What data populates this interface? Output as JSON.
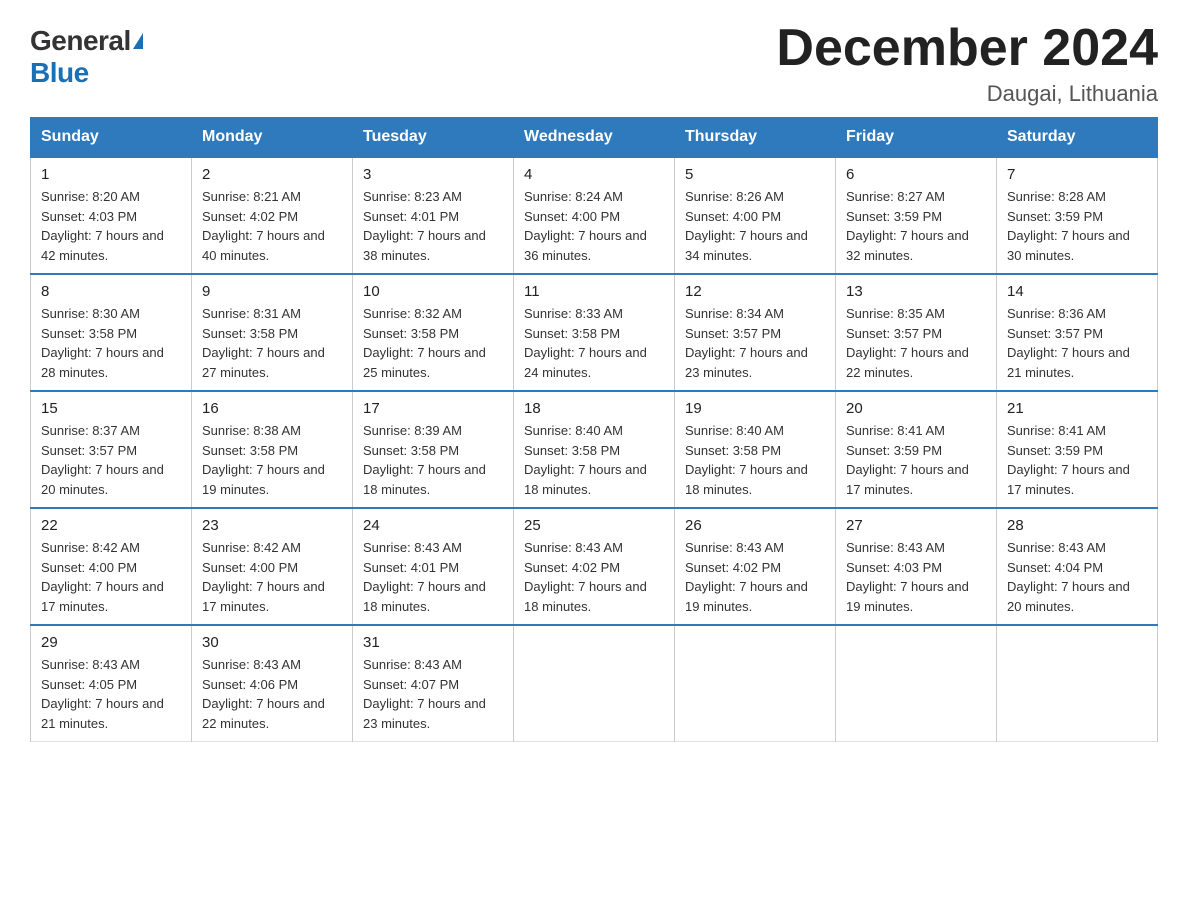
{
  "header": {
    "logo_general": "General",
    "logo_blue": "Blue",
    "month_title": "December 2024",
    "location": "Daugai, Lithuania"
  },
  "days_of_week": [
    "Sunday",
    "Monday",
    "Tuesday",
    "Wednesday",
    "Thursday",
    "Friday",
    "Saturday"
  ],
  "weeks": [
    [
      {
        "day": "1",
        "sunrise": "8:20 AM",
        "sunset": "4:03 PM",
        "daylight": "7 hours and 42 minutes."
      },
      {
        "day": "2",
        "sunrise": "8:21 AM",
        "sunset": "4:02 PM",
        "daylight": "7 hours and 40 minutes."
      },
      {
        "day": "3",
        "sunrise": "8:23 AM",
        "sunset": "4:01 PM",
        "daylight": "7 hours and 38 minutes."
      },
      {
        "day": "4",
        "sunrise": "8:24 AM",
        "sunset": "4:00 PM",
        "daylight": "7 hours and 36 minutes."
      },
      {
        "day": "5",
        "sunrise": "8:26 AM",
        "sunset": "4:00 PM",
        "daylight": "7 hours and 34 minutes."
      },
      {
        "day": "6",
        "sunrise": "8:27 AM",
        "sunset": "3:59 PM",
        "daylight": "7 hours and 32 minutes."
      },
      {
        "day": "7",
        "sunrise": "8:28 AM",
        "sunset": "3:59 PM",
        "daylight": "7 hours and 30 minutes."
      }
    ],
    [
      {
        "day": "8",
        "sunrise": "8:30 AM",
        "sunset": "3:58 PM",
        "daylight": "7 hours and 28 minutes."
      },
      {
        "day": "9",
        "sunrise": "8:31 AM",
        "sunset": "3:58 PM",
        "daylight": "7 hours and 27 minutes."
      },
      {
        "day": "10",
        "sunrise": "8:32 AM",
        "sunset": "3:58 PM",
        "daylight": "7 hours and 25 minutes."
      },
      {
        "day": "11",
        "sunrise": "8:33 AM",
        "sunset": "3:58 PM",
        "daylight": "7 hours and 24 minutes."
      },
      {
        "day": "12",
        "sunrise": "8:34 AM",
        "sunset": "3:57 PM",
        "daylight": "7 hours and 23 minutes."
      },
      {
        "day": "13",
        "sunrise": "8:35 AM",
        "sunset": "3:57 PM",
        "daylight": "7 hours and 22 minutes."
      },
      {
        "day": "14",
        "sunrise": "8:36 AM",
        "sunset": "3:57 PM",
        "daylight": "7 hours and 21 minutes."
      }
    ],
    [
      {
        "day": "15",
        "sunrise": "8:37 AM",
        "sunset": "3:57 PM",
        "daylight": "7 hours and 20 minutes."
      },
      {
        "day": "16",
        "sunrise": "8:38 AM",
        "sunset": "3:58 PM",
        "daylight": "7 hours and 19 minutes."
      },
      {
        "day": "17",
        "sunrise": "8:39 AM",
        "sunset": "3:58 PM",
        "daylight": "7 hours and 18 minutes."
      },
      {
        "day": "18",
        "sunrise": "8:40 AM",
        "sunset": "3:58 PM",
        "daylight": "7 hours and 18 minutes."
      },
      {
        "day": "19",
        "sunrise": "8:40 AM",
        "sunset": "3:58 PM",
        "daylight": "7 hours and 18 minutes."
      },
      {
        "day": "20",
        "sunrise": "8:41 AM",
        "sunset": "3:59 PM",
        "daylight": "7 hours and 17 minutes."
      },
      {
        "day": "21",
        "sunrise": "8:41 AM",
        "sunset": "3:59 PM",
        "daylight": "7 hours and 17 minutes."
      }
    ],
    [
      {
        "day": "22",
        "sunrise": "8:42 AM",
        "sunset": "4:00 PM",
        "daylight": "7 hours and 17 minutes."
      },
      {
        "day": "23",
        "sunrise": "8:42 AM",
        "sunset": "4:00 PM",
        "daylight": "7 hours and 17 minutes."
      },
      {
        "day": "24",
        "sunrise": "8:43 AM",
        "sunset": "4:01 PM",
        "daylight": "7 hours and 18 minutes."
      },
      {
        "day": "25",
        "sunrise": "8:43 AM",
        "sunset": "4:02 PM",
        "daylight": "7 hours and 18 minutes."
      },
      {
        "day": "26",
        "sunrise": "8:43 AM",
        "sunset": "4:02 PM",
        "daylight": "7 hours and 19 minutes."
      },
      {
        "day": "27",
        "sunrise": "8:43 AM",
        "sunset": "4:03 PM",
        "daylight": "7 hours and 19 minutes."
      },
      {
        "day": "28",
        "sunrise": "8:43 AM",
        "sunset": "4:04 PM",
        "daylight": "7 hours and 20 minutes."
      }
    ],
    [
      {
        "day": "29",
        "sunrise": "8:43 AM",
        "sunset": "4:05 PM",
        "daylight": "7 hours and 21 minutes."
      },
      {
        "day": "30",
        "sunrise": "8:43 AM",
        "sunset": "4:06 PM",
        "daylight": "7 hours and 22 minutes."
      },
      {
        "day": "31",
        "sunrise": "8:43 AM",
        "sunset": "4:07 PM",
        "daylight": "7 hours and 23 minutes."
      },
      null,
      null,
      null,
      null
    ]
  ]
}
